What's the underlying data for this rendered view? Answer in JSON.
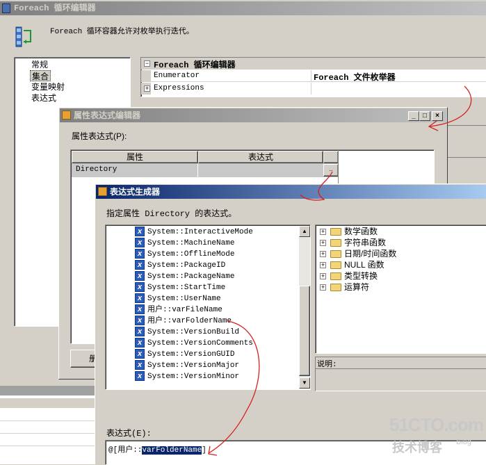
{
  "foreach_editor": {
    "title": "Foreach 循环编辑器",
    "description": "Foreach 循环容器允许对枚举执行迭代。",
    "nav_items": [
      "常规",
      "集合",
      "变量映射",
      "表达式"
    ],
    "props": {
      "group_label": "Foreach 循环编辑器",
      "enumerator_label": "Enumerator",
      "enumerator_value": "Foreach 文件枚举器",
      "expressions_label": "Expressions"
    }
  },
  "prop_expr_editor": {
    "title": "属性表达式编辑器",
    "label": "属性表达式(P):",
    "col_property": "属性",
    "col_expression": "表达式",
    "row_property": "Directory",
    "button_partial": "册"
  },
  "expr_builder": {
    "title": "表达式生成器",
    "prompt": "指定属性 Directory 的表达式。",
    "variables": [
      "System::InteractiveMode",
      "System::MachineName",
      "System::OfflineMode",
      "System::PackageID",
      "System::PackageName",
      "System::StartTime",
      "System::UserName",
      "用户::varFileName",
      "用户::varFolderName",
      "System::VersionBuild",
      "System::VersionComments",
      "System::VersionGUID",
      "System::VersionMajor",
      "System::VersionMinor"
    ],
    "functions": [
      "数学函数",
      "字符串函数",
      "日期/时间函数",
      "NULL 函数",
      "类型转换",
      "运算符"
    ],
    "description_label": "说明:",
    "expression_label": "表达式(E):",
    "expression_prefix": "@[用户::",
    "expression_selected": "varFolderName",
    "expression_suffix": "]"
  },
  "watermark": {
    "main": "51CTO.com",
    "sub": "技术博客",
    "tag": "Blog"
  },
  "colors": {
    "active_title": "#0a246a",
    "inactive_title": "#808080",
    "annotation": "#d42020",
    "selection": "#0a246a"
  }
}
